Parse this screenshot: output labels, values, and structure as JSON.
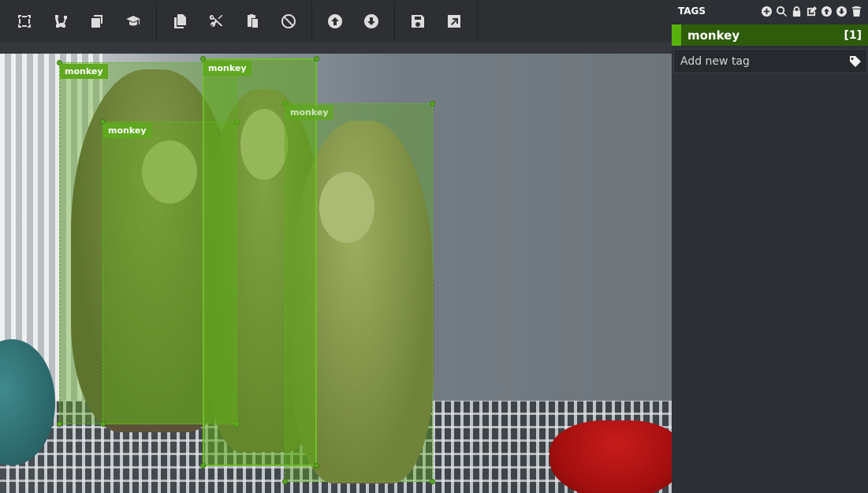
{
  "toolbar": {
    "groups": [
      [
        "draw-rectangle-icon",
        "draw-polygon-icon",
        "copy-rectangle-icon",
        "active-learning-icon"
      ],
      [
        "copy-regions-icon",
        "cut-regions-icon",
        "paste-regions-icon",
        "clear-regions-icon"
      ],
      [
        "previous-asset-icon",
        "next-asset-icon"
      ],
      [
        "save-project-icon",
        "export-project-icon"
      ]
    ]
  },
  "regions": [
    {
      "tag": "monkey",
      "selected": false,
      "faded": false
    },
    {
      "tag": "monkey",
      "selected": false,
      "faded": false
    },
    {
      "tag": "monkey",
      "selected": true,
      "faded": false
    },
    {
      "tag": "monkey",
      "selected": false,
      "faded": true
    }
  ],
  "tags_panel": {
    "title": "TAGS",
    "icons": [
      "add-tag-icon",
      "search-tags-icon",
      "lock-tags-icon",
      "edit-tag-icon",
      "move-tag-up-icon",
      "move-tag-down-icon",
      "delete-tag-icon"
    ],
    "tags": [
      {
        "name": "monkey",
        "count": "[1]",
        "color": "#59b20c"
      }
    ],
    "new_tag_placeholder": "Add new tag",
    "new_tag_icon": "tag-icon"
  }
}
